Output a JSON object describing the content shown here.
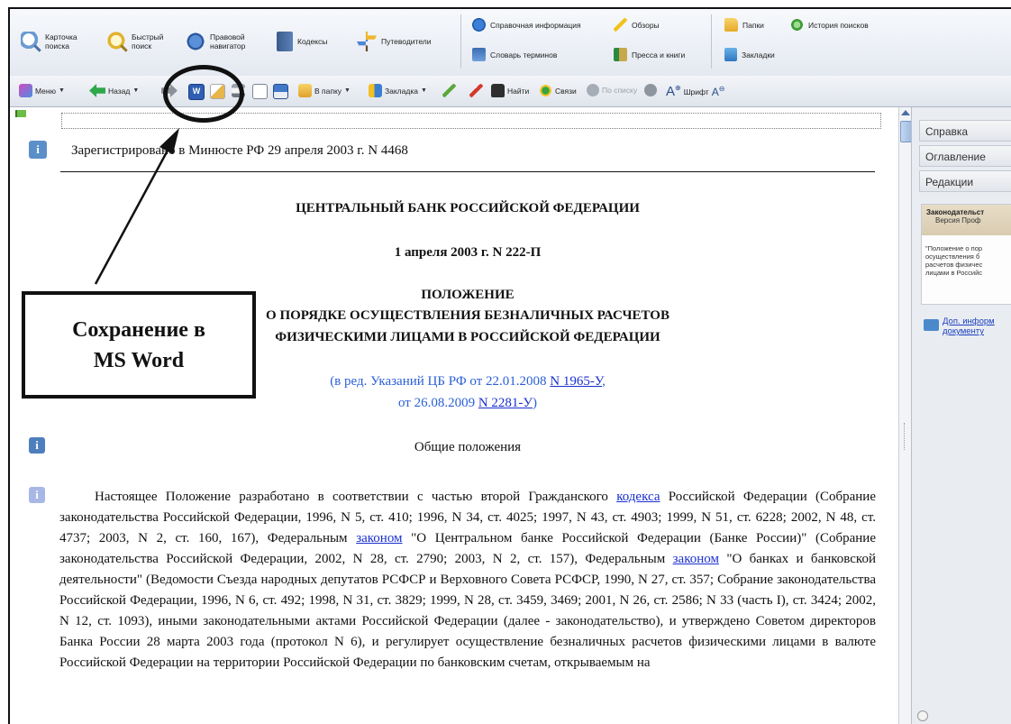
{
  "top_toolbar": {
    "card_search": "Карточка\nпоиска",
    "quick_search": "Быстрый\nпоиск",
    "legal_navigator": "Правовой\nнавигатор",
    "codes": "Кодексы",
    "guides": "Путеводители",
    "reference_info": "Справочная информация",
    "reviews": "Обзоры",
    "dictionary": "Словарь терминов",
    "press_books": "Пресса и книги",
    "folders": "Папки",
    "search_history": "История поисков",
    "bookmarks": "Закладки"
  },
  "second_toolbar": {
    "menu": "Меню",
    "back": "Назад",
    "to_folder": "В папку",
    "bookmark": "Закладка",
    "find": "Найти",
    "links": "Связи",
    "by_list": "По списку",
    "font": "Шрифт"
  },
  "document": {
    "registered": "Зарегистрировано в Минюсте РФ 29 апреля 2003 г. N 4468",
    "bank": "ЦЕНТРАЛЬНЫЙ БАНК РОССИЙСКОЙ ФЕДЕРАЦИИ",
    "date_number": "1 апреля 2003 г. N 222-П",
    "doc_type": "ПОЛОЖЕНИЕ",
    "title_line1": "О ПОРЯДКЕ ОСУЩЕСТВЛЕНИЯ БЕЗНАЛИЧНЫХ РАСЧЕТОВ",
    "title_line2": "ФИЗИЧЕСКИМИ ЛИЦАМИ В РОССИЙСКОЙ ФЕДЕРАЦИИ",
    "revision_prefix": "(в ред. Указаний ЦБ РФ от 22.01.2008 ",
    "revision_link1": "N 1965-У",
    "revision_mid": "от 26.08.2009 ",
    "revision_link2": "N 2281-У",
    "revision_suffix": ")",
    "section_title": "Общие положения",
    "para_part1": "Настоящее Положение разработано в соответствии с частью второй Гражданского ",
    "para_link1": "кодекса",
    "para_part2": " Российской Федерации (Собрание законодательства Российской Федерации, 1996, N 5, ст. 410; 1996, N 34, ст. 4025; 1997, N 43, ст. 4903; 1999, N 51, ст. 6228; 2002, N 48, ст. 4737; 2003, N 2, ст. 160, 167), Федеральным ",
    "para_link2": "законом",
    "para_part3": " \"О Центральном банке Российской Федерации (Банке России)\" (Собрание законодательства Российской Федерации, 2002, N 28, ст. 2790; 2003, N 2, ст. 157), Федеральным ",
    "para_link3": "законом",
    "para_part4": " \"О банках и банковской деятельности\" (Ведомости Съезда народных депутатов РСФСР и Верховного Совета РСФСР, 1990, N 27, ст. 357; Собрание законодательства Российской Федерации, 1996, N 6, ст. 492; 1998, N 31, ст. 3829; 1999, N 28, ст. 3459, 3469; 2001, N 26, ст. 2586; N 33 (часть I), ст. 3424; 2002, N 12, ст. 1093), иными законодательными актами Российской Федерации (далее - законодательство), и утверждено Советом директоров Банка России 28 марта 2003 года (протокол N 6), и регулирует осуществление безналичных расчетов физическими лицами в валюте Российской Федерации на территории Российской Федерации по банковским счетам, открываемым на"
  },
  "right_panel": {
    "tab_help": "Справка",
    "tab_contents": "Оглавление",
    "tab_revisions": "Редакции",
    "card_title": "Законодательст",
    "card_version": "Версия Проф",
    "card_text": "\"Положение о пор\nосуществления б\nрасчетов физичес\nлицами в Российс",
    "more_info": "Доп. информ\nдокументу"
  },
  "annotation": {
    "callout": "Сохранение в\nMS Word"
  }
}
